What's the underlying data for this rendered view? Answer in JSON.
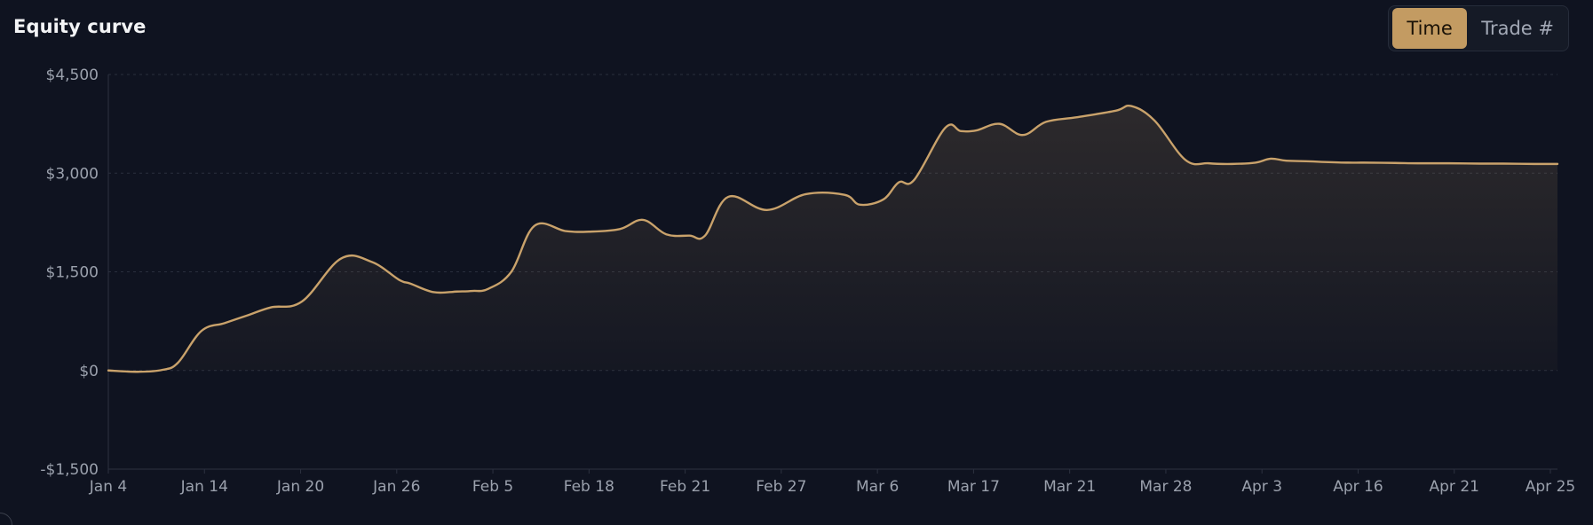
{
  "header": {
    "title": "Equity curve",
    "toggle": {
      "time_label": "Time",
      "trade_label": "Trade #",
      "selected": "Time"
    }
  },
  "colors": {
    "background": "#0f1320",
    "line": "#c9a26b",
    "accent": "#c39b62",
    "grid": "#2a2f3d",
    "tick_text": "#9ba1ad"
  },
  "chart_data": {
    "type": "area",
    "title": "",
    "xlabel": "",
    "ylabel": "",
    "ylim": [
      -1500,
      4500
    ],
    "yticks": [
      4500,
      3000,
      1500,
      0,
      -1500
    ],
    "ytick_labels": [
      "$4,500",
      "$3,000",
      "$1,500",
      "$0",
      "-$1,500"
    ],
    "xtick_labels": [
      "Jan 4",
      "Jan 14",
      "Jan 20",
      "Jan 26",
      "Feb 5",
      "Feb 18",
      "Feb 21",
      "Feb 27",
      "Mar 6",
      "Mar 17",
      "Mar 21",
      "Mar 28",
      "Apr 3",
      "Apr 16",
      "Apr 21",
      "Apr 25"
    ],
    "grid": true,
    "legend": "none",
    "series": [
      {
        "trade_index": [
          0,
          0.4,
          0.7,
          0.9,
          1.2,
          1.5,
          1.8,
          2.1,
          2.5,
          3.0,
          3.4,
          3.75,
          3.9,
          4.2,
          4.5,
          4.7,
          4.9,
          5.2,
          5.5,
          5.9,
          6.2,
          6.6,
          6.9,
          7.2,
          7.5,
          7.7,
          8.0,
          8.5,
          9.0,
          9.5,
          9.7,
          10.0,
          10.2,
          10.4,
          10.8,
          11.0,
          11.2,
          11.5,
          11.8,
          12.1,
          12.5,
          13.0,
          13.2,
          13.5,
          13.9,
          14.2,
          14.5,
          14.8,
          15.0,
          15.2,
          15.5,
          15.7,
          16.0,
          16.2,
          16.6,
          16.9,
          17.3,
          17.7,
          18.0,
          18.4,
          18.7
        ],
        "values": [
          0,
          -20,
          10,
          120,
          600,
          720,
          840,
          960,
          1050,
          1700,
          1650,
          1380,
          1320,
          1190,
          1200,
          1210,
          1240,
          1500,
          2200,
          2120,
          2110,
          2150,
          2290,
          2070,
          2050,
          2050,
          2640,
          2440,
          2680,
          2670,
          2520,
          2600,
          2860,
          2900,
          3690,
          3640,
          3650,
          3750,
          3580,
          3780,
          3850,
          3950,
          4020,
          3800,
          3200,
          3150,
          3140,
          3160,
          3220,
          3190,
          3180,
          3170,
          3160,
          3160,
          3155,
          3150,
          3150,
          3145,
          3145,
          3140,
          3140
        ]
      }
    ]
  }
}
